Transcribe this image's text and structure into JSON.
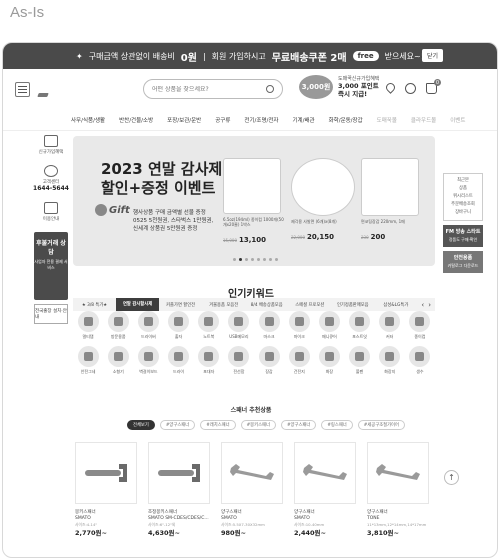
{
  "caption": "As-Is",
  "top_banner": {
    "text_1": "구매금액 상관없이 배송비",
    "strong_1": "0원",
    "separator": "|",
    "text_2": "회원 가입하시고",
    "strong_2": "무료배송쿠폰 2매",
    "free_badge": "free",
    "text_3": "받으세요~!",
    "close_label": "닫기"
  },
  "header": {
    "search_placeholder": "어떤 상품을 찾으세요?",
    "promo_coin": "3,000원",
    "promo_line1": "도매꾹신규가입혜택",
    "promo_line2": "3,000 포인트",
    "promo_line3": "즉시 지급!",
    "cart_count": "0"
  },
  "nav": {
    "items": [
      "사무/식품/생활",
      "반찬/건물/소방",
      "포장/보관/운반",
      "공구류",
      "전기/조명/전자",
      "기계/배관",
      "화학/운동/장갑"
    ],
    "muted": [
      "도매꾹몰",
      "클라우드몰",
      "이벤트"
    ]
  },
  "left_sidebar": {
    "items": [
      {
        "label": "신규가입혜택",
        "icon": "gift-icon"
      },
      {
        "label": "고객센터",
        "phone": "1644-5644",
        "icon": "headset-icon"
      },
      {
        "label": "이용안내",
        "icon": "info-icon"
      }
    ],
    "dark_banner": "후불거래 상담",
    "dark_banner_sub": "사업자 전용 결제 서비스",
    "card": "전국출장 설치·안내"
  },
  "hero": {
    "title_1": "2023 연말 감사제",
    "title_2": "할인+증정 이벤트",
    "gift_label": "Gift",
    "desc_1": "행사상품 구매 금액별 선물 증정",
    "desc_2": "0525 5천원권, 스타벅스 1만원권,",
    "desc_3": "신세계 상품권 5만원권 증정",
    "products": [
      {
        "name": "6.5oz(194ml) 종이컵 1000개(50개x20줄) 1박스",
        "old": "15,000",
        "price": "13,100"
      },
      {
        "name": "제각용 사발면 (6개)x(8개)",
        "old": "22,000",
        "price": "20,150"
      },
      {
        "name": "면코팅장갑 220mm, 1매",
        "old": "230",
        "price": "200"
      }
    ],
    "dots": 8
  },
  "category_tabs": {
    "items": [
      "★ 3/8 특가★",
      "연말 감사할사제",
      "커플가면 할인전",
      "겨울용품 모음전",
      "8/4 배송상품모음",
      "스페셜 프로모션",
      "인기정품판매모음",
      "삼성&LG특가"
    ],
    "active_index": 1,
    "prev": "‹",
    "next": "›"
  },
  "right_sidebar": {
    "box_lines": [
      "최근본",
      "상품",
      "위시리스트",
      "주문배송조회",
      "장바구니"
    ],
    "banner_1": "FM 방송 스타트",
    "banner_1_sub": "정품도 구매·확인",
    "banner_2": "안전용품",
    "banner_2_sub": "카탈로그 다운로드"
  },
  "keywords": {
    "title": "인기키워드",
    "items": [
      "멀티탭",
      "방문용품",
      "드라이버",
      "출자",
      "노트북",
      "USB메모리",
      "마스크",
      "마이크",
      "매니큐어",
      "포스트잇",
      "커터",
      "종이컵",
      "안전그네",
      "소형기",
      "벽걸이보드",
      "드라이",
      "포대자",
      "전선함",
      "장갑",
      "건전지",
      "화장",
      "볼펜",
      "화장지",
      "생수"
    ]
  },
  "recommended": {
    "title": "스패너 추천상품",
    "tags": [
      "전체보기",
      "#양구스패너",
      "#래치스패너",
      "#몽키스패너",
      "#양구스패너",
      "#링스패너",
      "#세공구조절가이어"
    ],
    "items": [
      {
        "name_1": "몽키스패너",
        "name_2": "SMATO",
        "meta": "사이즈:4-14\"",
        "price": "2,770원~"
      },
      {
        "name_1": "조정몽키스패너",
        "name_2": "SMATO SM-CDES/CDES/C...",
        "meta": "사이즈:6\"-12\"외",
        "price": "4,630원~"
      },
      {
        "name_1": "양구스패너",
        "name_2": "SMATO",
        "meta": "사이즈:5.5X7-30X32mm",
        "price": "980원~"
      },
      {
        "name_1": "양구스패너",
        "name_2": "SMATO",
        "meta": "사이즈:10-40mm",
        "price": "2,440원~"
      },
      {
        "name_1": "양구스패너",
        "name_2": "TONE",
        "meta": "11*13mm,12*14mm,14*17mm",
        "price": "3,810원~"
      }
    ],
    "up_icon": "↑"
  }
}
